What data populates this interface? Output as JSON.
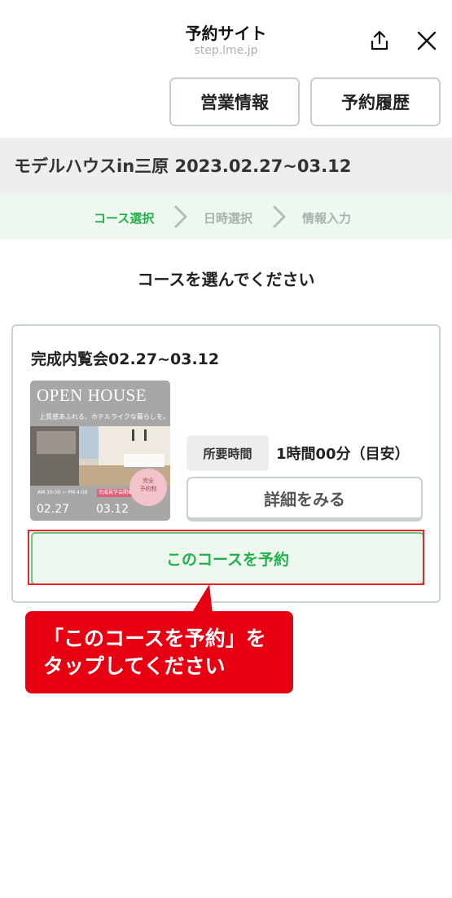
{
  "header": {
    "title": "予約サイト",
    "url": "step.lme.jp",
    "share_icon": "share-icon",
    "close_icon": "close-icon"
  },
  "top_buttons": {
    "business_info": "営業情報",
    "history": "予約履歴"
  },
  "event": {
    "title": "モデルハウスin三原 2023.02.27~03.12"
  },
  "steps": {
    "items": [
      "コース選択",
      "日時選択",
      "情報入力"
    ],
    "active_color": "#22b14c",
    "inactive_color": "#a9b2ae"
  },
  "section_title": "コースを選んでください",
  "course": {
    "title": "完成内覧会02.27~03.12",
    "poster": {
      "headline": "OPEN HOUSE",
      "subline": "上質感あふれる、ホテルライクな暮らしを。",
      "info": "AM 10:00 ~ PM 4:00",
      "tag": "完成見学会開催",
      "badge": "完全\n予約制",
      "date_start": "02.27",
      "date_end": "03.12"
    },
    "duration_label": "所要時間",
    "duration_value": "1時間00分（目安）",
    "detail_button": "詳細をみる",
    "reserve_button": "このコースを予約"
  },
  "callout": {
    "line1": "「このコースを予約」を",
    "line2": "タップしてください",
    "color": "#e60012"
  }
}
